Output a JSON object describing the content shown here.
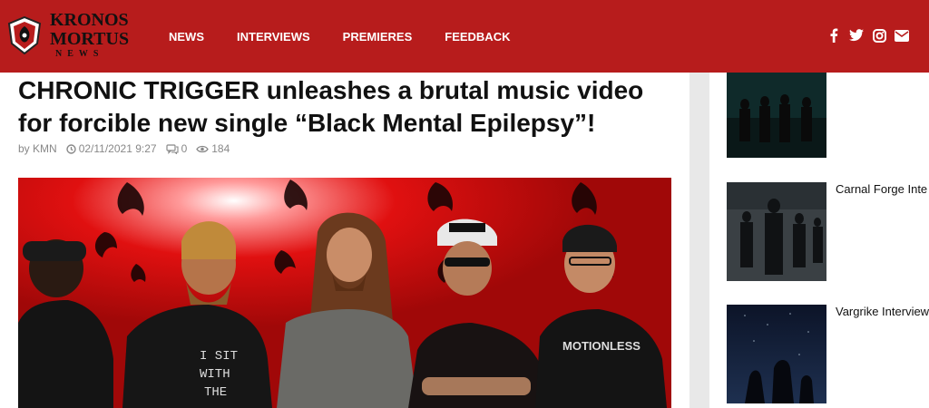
{
  "site": {
    "logo_line1": "KRONOS",
    "logo_line2": "MORTUS",
    "logo_line3": "NEWS",
    "brand_color": "#b71c1c"
  },
  "nav": {
    "items": [
      {
        "label": "NEWS"
      },
      {
        "label": "INTERVIEWS"
      },
      {
        "label": "PREMIERES"
      },
      {
        "label": "FEEDBACK"
      }
    ]
  },
  "social": [
    "facebook-icon",
    "twitter-icon",
    "instagram-icon",
    "email-icon"
  ],
  "article": {
    "title": "CHRONIC TRIGGER unleashes a brutal music video for forcible new single “Black Mental Epilepsy”!",
    "author_prefix": "by",
    "author": "KMN",
    "date": "02/11/2021 9:27",
    "comments": "0",
    "views": "184"
  },
  "sidebar": {
    "items": [
      {
        "title": ""
      },
      {
        "title": "Carnal Forge Inte"
      },
      {
        "title": "Vargrike Interview"
      }
    ]
  }
}
